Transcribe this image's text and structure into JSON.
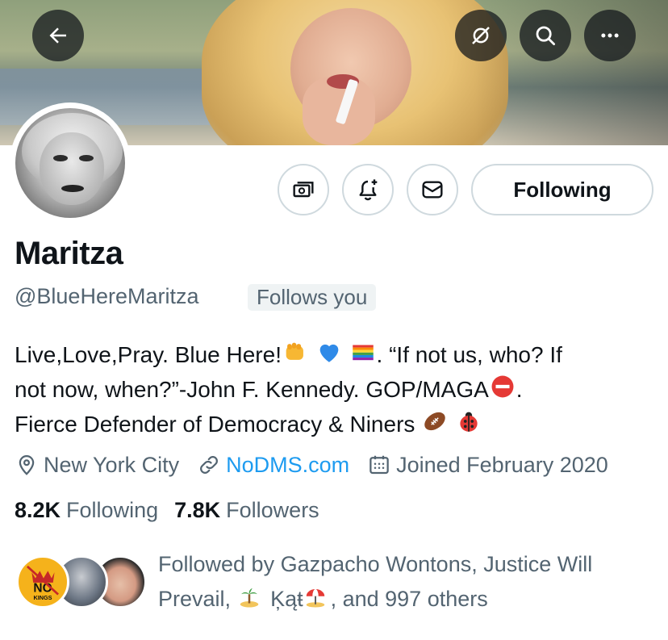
{
  "header": {
    "back_icon": "arrow-left-icon",
    "top_actions": [
      "translate-off-icon",
      "search-icon",
      "more-icon"
    ],
    "more_label": "•••"
  },
  "profile": {
    "name": "Maritza",
    "handle": "@BlueHereMaritza",
    "follows_you_label": "Follows you",
    "action_icons": [
      "subscribe-money-icon",
      "notification-bell-add-icon",
      "message-envelope-icon"
    ],
    "following_button_label": "Following",
    "bio": {
      "line1_part1": "Live,Love,Pray. Blue Here!",
      "line1_part2": ". “If not us, who? If",
      "line2_part1": "not now, when?”-John F. Kennedy. GOP/MAGA",
      "line2_part2": ".",
      "line3": "Fierce Defender of Democracy & Niners",
      "emojis": [
        "fist",
        "blue-heart",
        "rainbow-flag",
        "no-entry",
        "football",
        "ladybug"
      ]
    },
    "location": "New York City",
    "website": "NoDMS.com",
    "joined": "Joined February 2020",
    "following_count": "8.2K",
    "following_label": "Following",
    "followers_count": "7.8K",
    "followers_label": "Followers",
    "followed_by": {
      "part1": "Followed by Gazpacho Wontons, Justice Will",
      "part2_a": "Prevail, ",
      "part2_name": "Ķąŧ",
      "part2_b": ", and 997 others",
      "avatar_badge_text": "NO",
      "avatar_badge_sub": "KINGS"
    }
  },
  "colors": {
    "text_primary": "#0f1419",
    "text_secondary": "#536471",
    "link": "#1d9bf0",
    "border": "#cfd9de",
    "badge_bg": "#eff3f4"
  }
}
